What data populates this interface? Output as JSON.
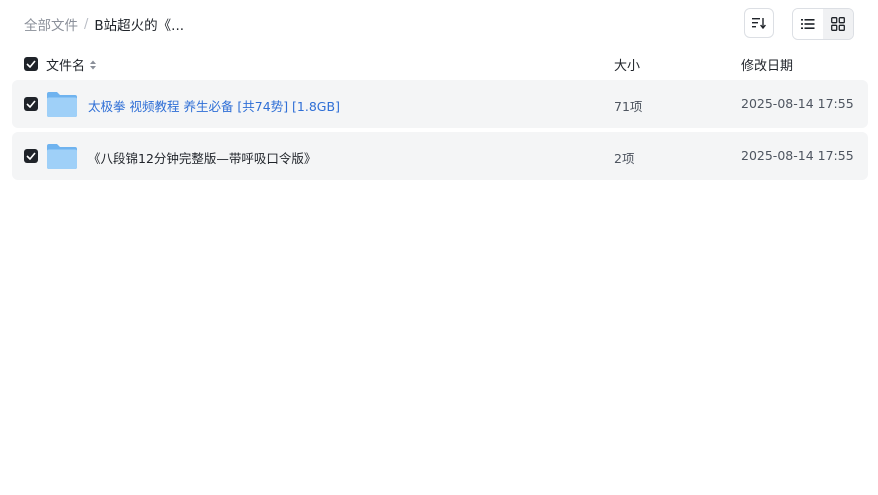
{
  "breadcrumb": {
    "root": "全部文件",
    "separator": "/",
    "current": "B站超火的《..."
  },
  "toolbar": {
    "sort_icon": "sort-descending-icon",
    "list_view_icon": "list-view-icon",
    "grid_view_icon": "grid-view-icon",
    "active_view": "list"
  },
  "columns": {
    "name": "文件名",
    "size": "大小",
    "date": "修改日期"
  },
  "rows": [
    {
      "name": "太极拳 视频教程 养生必备 [共74势] [1.8GB]",
      "size": "71项",
      "date": "2025-08-14 17:55",
      "checked": true,
      "is_link": true,
      "icon": "folder-icon"
    },
    {
      "name": "《八段锦12分钟完整版—带呼吸口令版》",
      "size": "2项",
      "date": "2025-08-14 17:55",
      "checked": true,
      "is_link": false,
      "icon": "folder-icon"
    }
  ],
  "colors": {
    "link": "#2f6fd6",
    "row_bg": "#f4f5f6",
    "checkbox": "#1f2329",
    "folder": "#8cc4f5"
  }
}
